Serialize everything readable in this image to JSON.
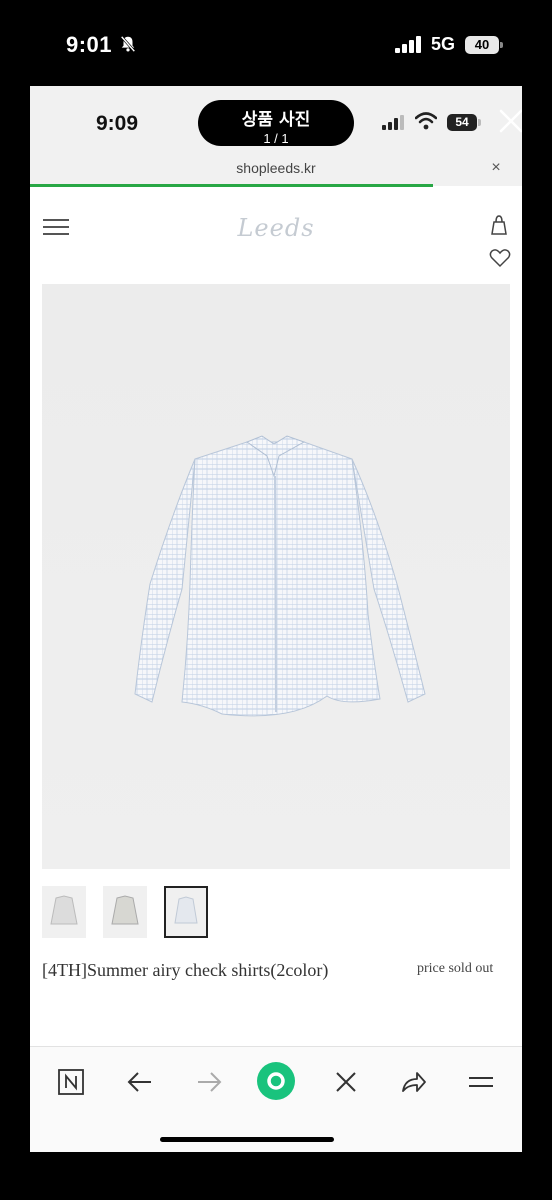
{
  "outer_status": {
    "time": "9:01",
    "network": "5G",
    "battery": "40"
  },
  "inner_status": {
    "time": "9:09",
    "battery": "54"
  },
  "viewer": {
    "title": "상품 사진",
    "count": "1 / 1"
  },
  "browser": {
    "url": "shopleeds.kr",
    "load_progress": 0.82
  },
  "site": {
    "logo": "Leeds"
  },
  "product": {
    "name": "[4TH]Summer airy check shirts(2color)",
    "price": "price sold out",
    "thumbnails": [
      {
        "label": "thumbnail-1",
        "selected": false
      },
      {
        "label": "thumbnail-2",
        "selected": false
      },
      {
        "label": "thumbnail-3",
        "selected": true
      }
    ]
  },
  "icons": {
    "status": [
      "bell-slash-icon",
      "signal-icon",
      "wifi-icon",
      "battery-icon"
    ],
    "header": [
      "menu-icon",
      "bag-icon",
      "heart-icon"
    ],
    "toolbar": [
      "naver-icon",
      "back-arrow-icon",
      "forward-arrow-icon",
      "green-home-icon",
      "close-icon",
      "share-icon",
      "menu-icon"
    ]
  },
  "colors": {
    "progress": "#28a745",
    "home_button": "#19c37d",
    "check_pattern": "#a9bfdc"
  }
}
